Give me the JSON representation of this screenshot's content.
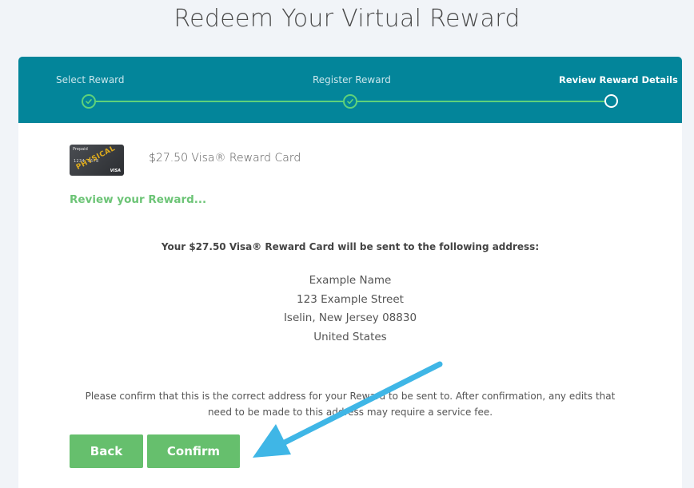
{
  "page": {
    "title": "Redeem Your Virtual Reward"
  },
  "stepper": {
    "steps": [
      {
        "label": "Select Reward",
        "status": "completed"
      },
      {
        "label": "Register Reward",
        "status": "completed"
      },
      {
        "label": "Review Reward Details",
        "status": "current"
      }
    ]
  },
  "reward": {
    "card_image_stamp": "PHYSICAL",
    "name": "$27.50 Visa® Reward Card"
  },
  "review": {
    "heading": "Review your Reward...",
    "intro": "Your $27.50 Visa® Reward Card will be sent to the following address:",
    "address": {
      "name": "Example Name",
      "street": "123 Example Street",
      "city_state_zip": "Iselin, New Jersey 08830",
      "country": "United States"
    },
    "confirm_note_line1": "Please confirm that this is the correct address for your Reward to be sent to. After confirmation, any edits that",
    "confirm_note_line2": "need to be made to this address may require a service fee."
  },
  "actions": {
    "back_label": "Back",
    "confirm_label": "Confirm"
  },
  "colors": {
    "stepper_bg": "#03859a",
    "progress_green": "#5fd27a",
    "button_green": "#66bf6d",
    "heading_green": "#6cc476",
    "annotation_arrow": "#3fb6e6"
  },
  "icons": {
    "completed_step": "check-circle-icon",
    "current_step": "open-circle-icon",
    "annotation": "arrow-icon"
  }
}
